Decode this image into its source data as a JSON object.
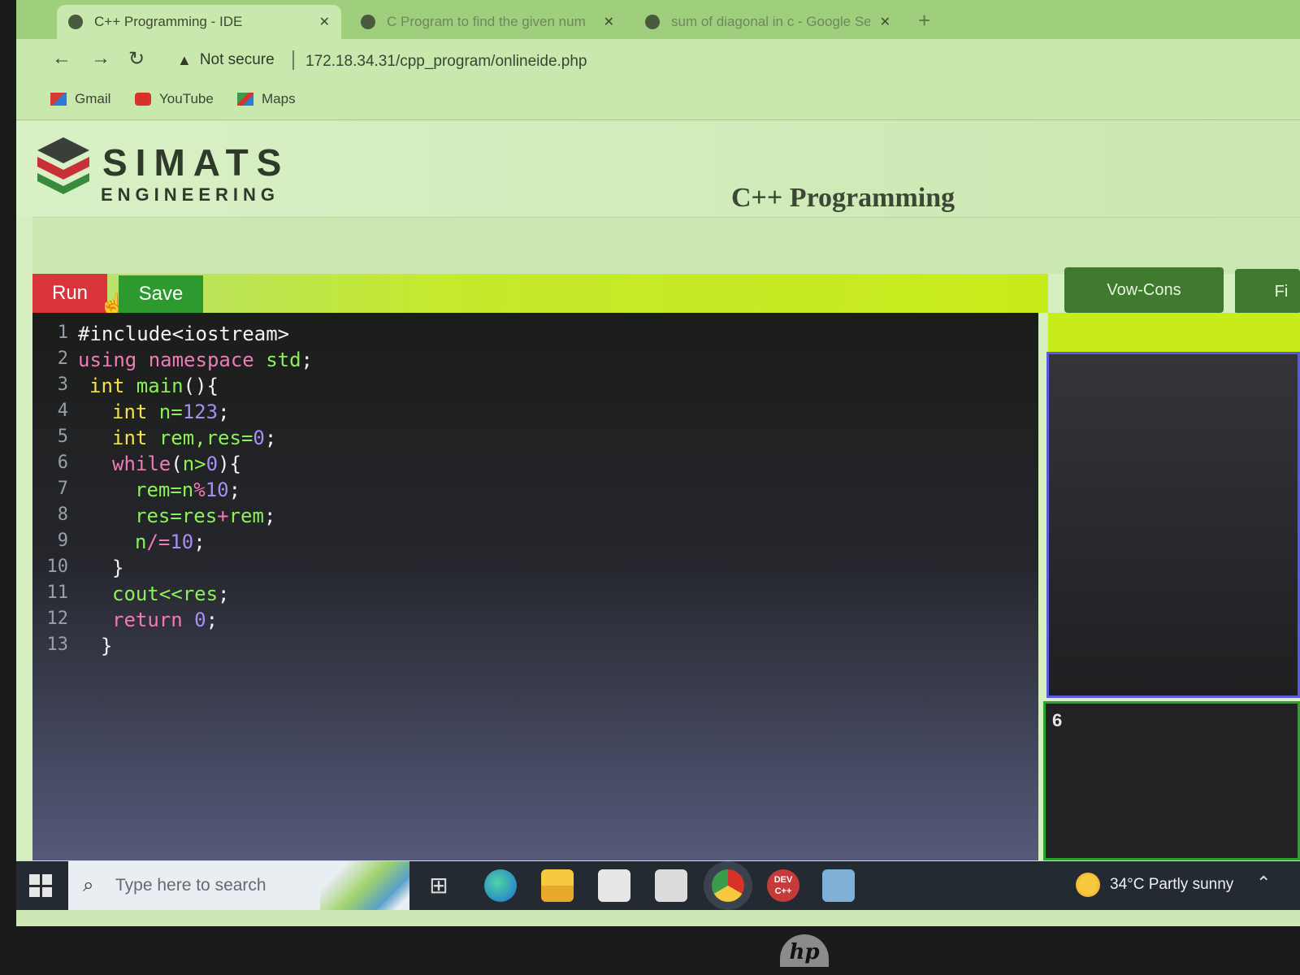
{
  "browser": {
    "tabs": [
      {
        "title": "C++ Programming - IDE",
        "active": true
      },
      {
        "title": "C Program to find the given num",
        "active": false
      },
      {
        "title": "sum of diagonal in c - Google Se",
        "active": false
      }
    ],
    "new_tab_label": "+",
    "security_label": "Not secure",
    "url": "172.18.34.31/cpp_program/onlineide.php",
    "bookmarks": [
      "Gmail",
      "YouTube",
      "Maps"
    ]
  },
  "header": {
    "logo_name": "SIMATS",
    "logo_sub": "ENGINEERING",
    "page_title": "C++ Programming"
  },
  "toolbar": {
    "run_label": "Run",
    "save_label": "Save",
    "vow_label": "Vow-Cons",
    "f_label": "Fi"
  },
  "editor": {
    "lines": [
      {
        "n": "1",
        "indent": 0,
        "tokens": [
          {
            "t": "#include<iostream>",
            "c": "op"
          }
        ]
      },
      {
        "n": "2",
        "indent": 0,
        "tokens": [
          {
            "t": "using namespace ",
            "c": "kw"
          },
          {
            "t": "std",
            "c": "id"
          },
          {
            "t": ";",
            "c": "op"
          }
        ]
      },
      {
        "n": "3",
        "indent": 1,
        "tokens": [
          {
            "t": "int ",
            "c": "ty"
          },
          {
            "t": "main",
            "c": "id"
          },
          {
            "t": "(){",
            "c": "op"
          }
        ]
      },
      {
        "n": "4",
        "indent": 3,
        "tokens": [
          {
            "t": "int ",
            "c": "ty"
          },
          {
            "t": "n=",
            "c": "id"
          },
          {
            "t": "123",
            "c": "nm"
          },
          {
            "t": ";",
            "c": "op"
          }
        ]
      },
      {
        "n": "5",
        "indent": 3,
        "tokens": [
          {
            "t": "int ",
            "c": "ty"
          },
          {
            "t": "rem,res=",
            "c": "id"
          },
          {
            "t": "0",
            "c": "nm"
          },
          {
            "t": ";",
            "c": "op"
          }
        ]
      },
      {
        "n": "6",
        "indent": 3,
        "tokens": [
          {
            "t": "while",
            "c": "kw"
          },
          {
            "t": "(",
            "c": "op"
          },
          {
            "t": "n>",
            "c": "id"
          },
          {
            "t": "0",
            "c": "nm"
          },
          {
            "t": "){",
            "c": "op"
          }
        ]
      },
      {
        "n": "7",
        "indent": 5,
        "tokens": [
          {
            "t": "rem=n",
            "c": "id"
          },
          {
            "t": "%",
            "c": "kw"
          },
          {
            "t": "10",
            "c": "nm"
          },
          {
            "t": ";",
            "c": "op"
          }
        ]
      },
      {
        "n": "8",
        "indent": 5,
        "tokens": [
          {
            "t": "res=res",
            "c": "id"
          },
          {
            "t": "+",
            "c": "kw"
          },
          {
            "t": "rem",
            "c": "id"
          },
          {
            "t": ";",
            "c": "op"
          }
        ]
      },
      {
        "n": "9",
        "indent": 5,
        "tokens": [
          {
            "t": "n",
            "c": "id"
          },
          {
            "t": "/=",
            "c": "kw"
          },
          {
            "t": "10",
            "c": "nm"
          },
          {
            "t": ";",
            "c": "op"
          }
        ]
      },
      {
        "n": "10",
        "indent": 3,
        "tokens": [
          {
            "t": "}",
            "c": "op"
          }
        ]
      },
      {
        "n": "11",
        "indent": 3,
        "tokens": [
          {
            "t": "cout<<res",
            "c": "id"
          },
          {
            "t": ";",
            "c": "op"
          }
        ]
      },
      {
        "n": "12",
        "indent": 3,
        "tokens": [
          {
            "t": "return ",
            "c": "kw"
          },
          {
            "t": "0",
            "c": "nm"
          },
          {
            "t": ";",
            "c": "op"
          }
        ]
      },
      {
        "n": "13",
        "indent": 2,
        "tokens": [
          {
            "t": "}",
            "c": "op"
          }
        ]
      }
    ]
  },
  "output": {
    "text": "6"
  },
  "taskbar": {
    "search_placeholder": "Type here to search",
    "dev_label": "DEV C++",
    "weather": "34°C  Partly sunny"
  },
  "bezel": {
    "brand": "hp"
  },
  "colors": {
    "run": "#d9343a",
    "save": "#2c9a2e",
    "accent_lime": "#c8ec1a",
    "keyword": "#f07ab8",
    "type": "#f3e24a",
    "identifier": "#8df05a",
    "number": "#a98cf5"
  }
}
